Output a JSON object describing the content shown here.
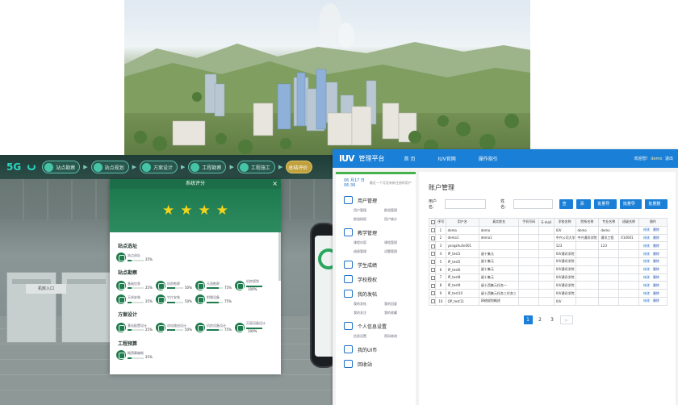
{
  "game": {
    "logo": "5G",
    "steps": [
      {
        "label": "站点勘察",
        "active": false
      },
      {
        "label": "站点规划",
        "active": false
      },
      {
        "label": "方案设计",
        "active": false
      },
      {
        "label": "工程勘察",
        "active": false
      },
      {
        "label": "工程施工",
        "active": false
      },
      {
        "label": "总结评价",
        "active": true
      }
    ],
    "sign": "机房入口"
  },
  "modal": {
    "title": "系统评分",
    "close": "×",
    "stars": 4,
    "sections": [
      {
        "title": "站点选址",
        "items": [
          {
            "label": "站点选址",
            "value": 0.25,
            "pct": "25%"
          }
        ]
      },
      {
        "title": "站点勘察",
        "items": [
          {
            "label": "基础信息",
            "value": 0.25,
            "pct": "25%"
          },
          {
            "label": "机房勘察",
            "value": 0.5,
            "pct": "50%"
          },
          {
            "label": "天面勘察",
            "value": 0.75,
            "pct": "75%"
          },
          {
            "label": "机房规划",
            "value": 1.0,
            "pct": "100%"
          },
          {
            "label": "天线安装",
            "value": 0.25,
            "pct": "25%"
          },
          {
            "label": "竹片安装",
            "value": 0.5,
            "pct": "50%"
          },
          {
            "label": "附属设备",
            "value": 0.75,
            "pct": "75%"
          }
        ]
      },
      {
        "title": "方案设计",
        "items": [
          {
            "label": "基站配置设计",
            "value": 0.25,
            "pct": "25%"
          },
          {
            "label": "进站路由设计",
            "value": 0.5,
            "pct": "50%"
          },
          {
            "label": "机房设备设计",
            "value": 0.75,
            "pct": "75%"
          },
          {
            "label": "天面设备设计",
            "value": 1.0,
            "pct": "100%"
          }
        ]
      },
      {
        "title": "工程预算",
        "items": [
          {
            "label": "概预算编制",
            "value": 0.25,
            "pct": "25%"
          }
        ]
      }
    ]
  },
  "admin": {
    "logo": "IUV",
    "title": "管理平台",
    "nav": [
      "首 页",
      "IUV官网",
      "操作指引"
    ],
    "welcome": "欢迎您!",
    "user": "demo",
    "logout": "退出",
    "date_line1": "06 月17 日",
    "date_line2": "06:36",
    "date_note": "最近一个月没有新注册的用户",
    "menu": [
      {
        "label": "用户管理",
        "subs": [
          "用户管理",
          "群组管理",
          "群组授权",
          "用户统计"
        ]
      },
      {
        "label": "教学管理",
        "subs": [
          "课程内容",
          "课程管理",
          "成绩管理",
          "试题管理"
        ]
      },
      {
        "label": "学生成绩",
        "subs": []
      },
      {
        "label": "学校授权",
        "subs": []
      },
      {
        "label": "我的发帖",
        "subs": [
          "我的发帖",
          "我的回复",
          "我的关注",
          "我的收藏"
        ]
      },
      {
        "label": "个人信息设置",
        "subs": [
          "信息设置",
          "密码修改"
        ]
      },
      {
        "label": "我的UI币",
        "subs": []
      },
      {
        "label": "回收站",
        "subs": []
      }
    ],
    "page_title": "账户管理",
    "search": {
      "user_label": "用户名:",
      "name_label": "姓名:"
    },
    "buttons": [
      "查询",
      "添加",
      "批量导入",
      "批量导出",
      "批量删除"
    ],
    "columns": [
      "序号",
      "用户名",
      "真实姓名",
      "手机号码",
      "E-mail",
      "学校名称",
      "院系名称",
      "专业名称",
      "班级名称",
      "操作"
    ],
    "rows": [
      [
        "1",
        "demo",
        "demo",
        "",
        "",
        "IUV",
        "demo",
        "demo",
        "",
        ""
      ],
      [
        "2",
        "demo1",
        "demo1",
        "",
        "",
        "中兴公司大学",
        "中兴通讯学院",
        "通讯工程",
        "X10001",
        ""
      ],
      [
        "3",
        "yangzhulin001",
        "",
        "",
        "",
        "123",
        "",
        "123",
        "",
        ""
      ],
      [
        "4",
        "IP_test1",
        "留十集元",
        "",
        "",
        "IUV通讯学院",
        "",
        "",
        "",
        ""
      ],
      [
        "5",
        "IP_test5",
        "留十集元",
        "",
        "",
        "IUV通讯学院",
        "",
        "",
        "",
        ""
      ],
      [
        "6",
        "IP_test6",
        "留十集元",
        "",
        "",
        "IUV通讯学院",
        "",
        "",
        "",
        ""
      ],
      [
        "7",
        "IP_test8",
        "留十集元",
        "",
        "",
        "IUV通讯学院",
        "",
        "",
        "",
        ""
      ],
      [
        "8",
        "IP_test9",
        "留十西集元任务一",
        "",
        "",
        "IUV通讯学院",
        "",
        "",
        "",
        ""
      ],
      [
        "9",
        "IP_test10",
        "留十西集元任务三任务三",
        "",
        "",
        "IUV通讯学院",
        "",
        "",
        "",
        ""
      ],
      [
        "10",
        "QP_test11",
        "网络规划概述",
        "",
        "",
        "IUV",
        "",
        "",
        "",
        ""
      ]
    ],
    "ops": [
      "修改",
      "删除"
    ],
    "pages": [
      "1",
      "2",
      "3",
      ">"
    ]
  }
}
